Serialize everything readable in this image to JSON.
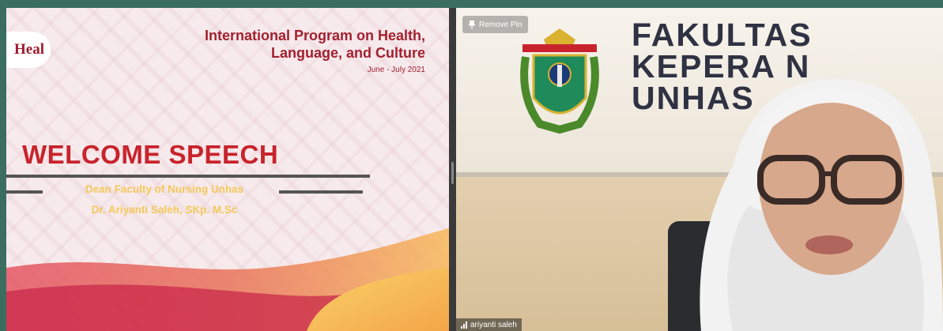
{
  "slide": {
    "logo_text": "Heal",
    "program_title_line1": "International Program on Health,",
    "program_title_line2": "Language, and Culture",
    "program_date": "June - July 2021",
    "heading": "WELCOME SPEECH",
    "speaker_role": "Dean Faculty of Nursing Unhas",
    "speaker_name": "Dr. Ariyanti Saleh, SKp. M.Sc"
  },
  "video": {
    "remove_pin_label": "Remove Pin",
    "sign_line1": "FAKULTAS",
    "sign_line2": "KEPERA        N",
    "sign_line3": "UNHAS",
    "participant_name": "ariyanti saleh"
  },
  "colors": {
    "background": "#3b6e5f",
    "slide_accent": "#c8232c",
    "speaker_text": "#f3c85a"
  }
}
